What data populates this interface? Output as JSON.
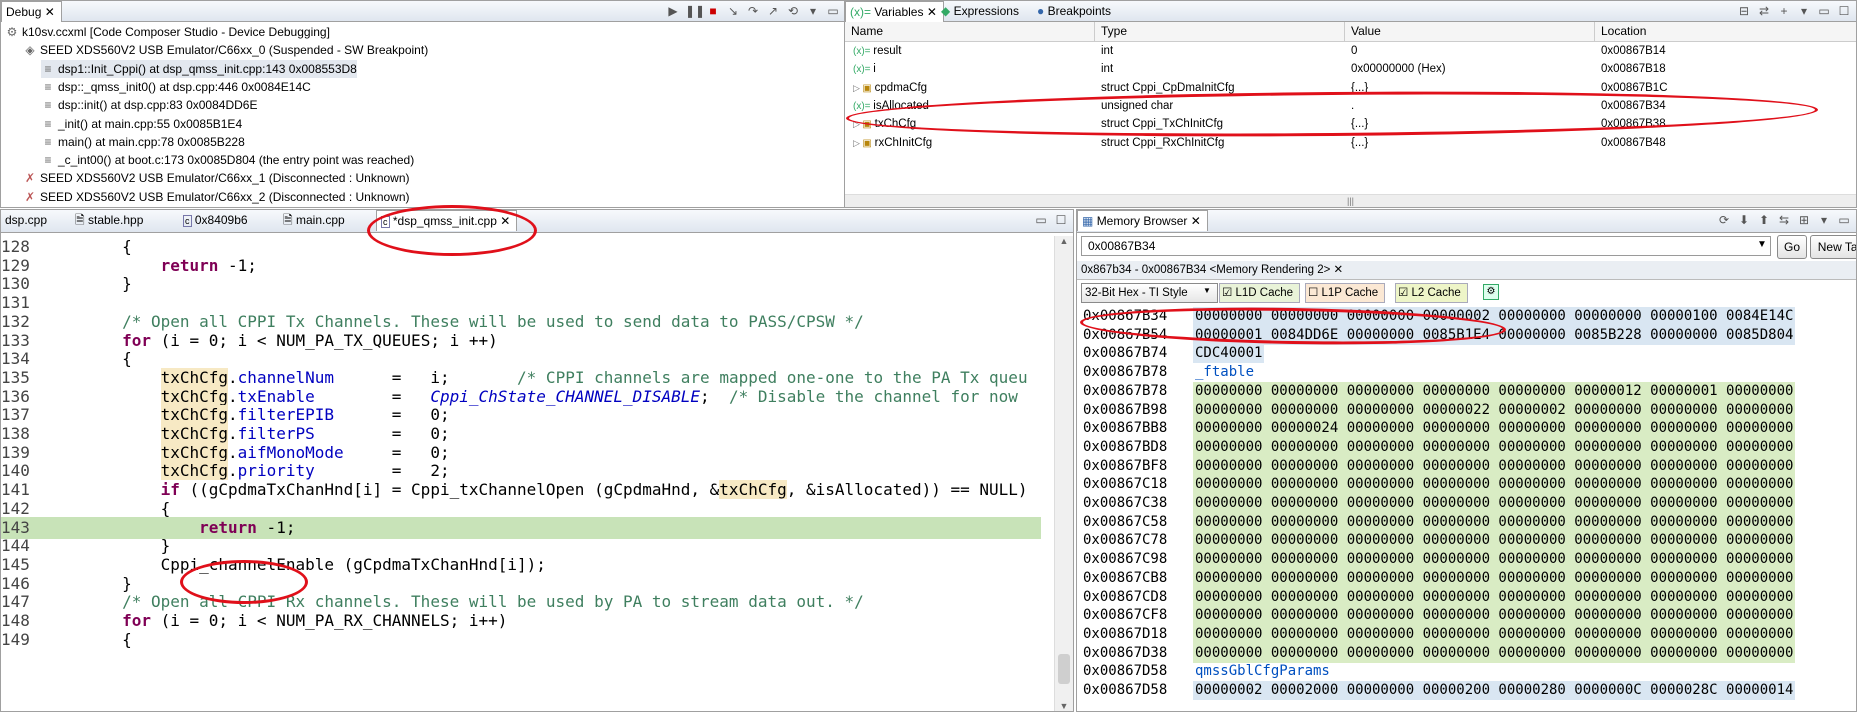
{
  "debug": {
    "tab_label": "Debug",
    "items": [
      {
        "text": "k10sv.ccxml [Code Composer Studio - Device Debugging]"
      },
      {
        "text": "SEED XDS560V2 USB Emulator/C66xx_0 (Suspended - SW Breakpoint)"
      },
      {
        "text": "dsp1::Init_Cppi() at dsp_qmss_init.cpp:143 0x008553D8"
      },
      {
        "text": "dsp::_qmss_init0() at dsp.cpp:446 0x0084E14C"
      },
      {
        "text": "dsp::init() at dsp.cpp:83 0x0084DD6E"
      },
      {
        "text": "_init() at main.cpp:55 0x0085B1E4"
      },
      {
        "text": "main() at main.cpp:78 0x0085B228"
      },
      {
        "text": "_c_int00() at boot.c:173 0x0085D804  (the entry point was reached)"
      },
      {
        "text": "SEED XDS560V2 USB Emulator/C66xx_1 (Disconnected : Unknown)"
      },
      {
        "text": "SEED XDS560V2 USB Emulator/C66xx_2 (Disconnected : Unknown)"
      }
    ]
  },
  "variables": {
    "tabs": [
      "Variables",
      "Expressions",
      "Breakpoints"
    ],
    "columns": [
      "Name",
      "Type",
      "Value",
      "Location"
    ],
    "rows": [
      {
        "name": "result",
        "type": "int",
        "value": "0",
        "location": "0x00867B14"
      },
      {
        "name": "i",
        "type": "int",
        "value": "0x00000000 (Hex)",
        "location": "0x00867B18"
      },
      {
        "name": "cpdmaCfg",
        "type": "struct Cppi_CpDmaInitCfg",
        "value": "{...}",
        "location": "0x00867B1C"
      },
      {
        "name": "isAllocated",
        "type": "unsigned char",
        "value": ".",
        "location": "0x00867B34"
      },
      {
        "name": "txChCfg",
        "type": "struct Cppi_TxChInitCfg",
        "value": "{...}",
        "location": "0x00867B38"
      },
      {
        "name": "rxChInitCfg",
        "type": "struct Cppi_RxChInitCfg",
        "value": "{...}",
        "location": "0x00867B48"
      }
    ]
  },
  "editor": {
    "tabs": [
      "dsp.cpp",
      "stable.hpp",
      "0x8409b6",
      "main.cpp",
      "*dsp_qmss_init.cpp"
    ],
    "lines": [
      {
        "n": "128",
        "t": "        {"
      },
      {
        "n": "129",
        "t": "            return -1;"
      },
      {
        "n": "130",
        "t": "        }"
      },
      {
        "n": "131",
        "t": ""
      },
      {
        "n": "132",
        "t": "        /* Open all CPPI Tx Channels. These will be used to send data to PASS/CPSW */"
      },
      {
        "n": "133",
        "t": "        for (i = 0; i < NUM_PA_TX_QUEUES; i ++)"
      },
      {
        "n": "134",
        "t": "        {"
      },
      {
        "n": "135",
        "t": "            txChCfg.channelNum      =   i;       /* CPPI channels are mapped one-one to the PA Tx queu"
      },
      {
        "n": "136",
        "t": "            txChCfg.txEnable        =   Cppi_ChState_CHANNEL_DISABLE;  /* Disable the channel for now"
      },
      {
        "n": "137",
        "t": "            txChCfg.filterEPIB      =   0;"
      },
      {
        "n": "138",
        "t": "            txChCfg.filterPS        =   0;"
      },
      {
        "n": "139",
        "t": "            txChCfg.aifMonoMode     =   0;"
      },
      {
        "n": "140",
        "t": "            txChCfg.priority        =   2;"
      },
      {
        "n": "141",
        "t": "            if ((gCpdmaTxChanHnd[i] = Cppi_txChannelOpen (gCpdmaHnd, &txChCfg, &isAllocated)) == NULL)"
      },
      {
        "n": "142",
        "t": "            {"
      },
      {
        "n": "143",
        "t": "                return -1;"
      },
      {
        "n": "144",
        "t": "            }"
      },
      {
        "n": "145",
        "t": "            Cppi_channelEnable (gCpdmaTxChanHnd[i]);"
      },
      {
        "n": "146",
        "t": "        }"
      },
      {
        "n": "147",
        "t": "        /* Open all CPPI Rx channels. These will be used by PA to stream data out. */"
      },
      {
        "n": "148",
        "t": "        for (i = 0; i < NUM_PA_RX_CHANNELS; i++)"
      },
      {
        "n": "149",
        "t": "        {"
      }
    ]
  },
  "memory": {
    "tab_label": "Memory Browser",
    "address_input": "0x00867B34",
    "go_label": "Go",
    "newtab_label": "New Tab",
    "rendering_tab": "0x867b34 - 0x00867B34 <Memory Rendering 2>",
    "format_select": "32-Bit Hex - TI Style",
    "cache_l1d": "L1D Cache",
    "cache_l1p": "L1P Cache",
    "cache_l2": "L2 Cache",
    "rows": [
      {
        "addr": "0x00867B34",
        "data": "00000000 00000000 00000000 00000002 00000000 00000000 00000100 0084E14C",
        "bg": "blue"
      },
      {
        "addr": "0x00867B54",
        "data": "00000001 0084DD6E 00000000 0085B1E4 00000000 0085B228 00000000 0085D804",
        "bg": "blue"
      },
      {
        "addr": "0x00867B74",
        "data": "CDC40001",
        "bg": "blue"
      },
      {
        "addr": "0x00867B78",
        "data": "_ftable",
        "bg": "label"
      },
      {
        "addr": "0x00867B78",
        "data": "00000000 00000000 00000000 00000000 00000000 00000012 00000001 00000000",
        "bg": "green"
      },
      {
        "addr": "0x00867B98",
        "data": "00000000 00000000 00000000 00000022 00000002 00000000 00000000 00000000",
        "bg": "green"
      },
      {
        "addr": "0x00867BB8",
        "data": "00000000 00000024 00000000 00000000 00000000 00000000 00000000 00000000",
        "bg": "green"
      },
      {
        "addr": "0x00867BD8",
        "data": "00000000 00000000 00000000 00000000 00000000 00000000 00000000 00000000",
        "bg": "green"
      },
      {
        "addr": "0x00867BF8",
        "data": "00000000 00000000 00000000 00000000 00000000 00000000 00000000 00000000",
        "bg": "green"
      },
      {
        "addr": "0x00867C18",
        "data": "00000000 00000000 00000000 00000000 00000000 00000000 00000000 00000000",
        "bg": "green"
      },
      {
        "addr": "0x00867C38",
        "data": "00000000 00000000 00000000 00000000 00000000 00000000 00000000 00000000",
        "bg": "green"
      },
      {
        "addr": "0x00867C58",
        "data": "00000000 00000000 00000000 00000000 00000000 00000000 00000000 00000000",
        "bg": "green"
      },
      {
        "addr": "0x00867C78",
        "data": "00000000 00000000 00000000 00000000 00000000 00000000 00000000 00000000",
        "bg": "green"
      },
      {
        "addr": "0x00867C98",
        "data": "00000000 00000000 00000000 00000000 00000000 00000000 00000000 00000000",
        "bg": "green"
      },
      {
        "addr": "0x00867CB8",
        "data": "00000000 00000000 00000000 00000000 00000000 00000000 00000000 00000000",
        "bg": "green"
      },
      {
        "addr": "0x00867CD8",
        "data": "00000000 00000000 00000000 00000000 00000000 00000000 00000000 00000000",
        "bg": "green"
      },
      {
        "addr": "0x00867CF8",
        "data": "00000000 00000000 00000000 00000000 00000000 00000000 00000000 00000000",
        "bg": "green"
      },
      {
        "addr": "0x00867D18",
        "data": "00000000 00000000 00000000 00000000 00000000 00000000 00000000 00000000",
        "bg": "green"
      },
      {
        "addr": "0x00867D38",
        "data": "00000000 00000000 00000000 00000000 00000000 00000000 00000000 00000000",
        "bg": "green"
      },
      {
        "addr": "0x00867D58",
        "data": "qmssGblCfgParams",
        "bg": "label"
      },
      {
        "addr": "0x00867D58",
        "data": "00000002 00002000 00000000 00000200 00000280 0000000C 0000028C 00000014",
        "bg": "blue"
      }
    ]
  },
  "colors": {
    "annotation": "#e0101a",
    "current_line": "#c8e3b8",
    "memory_changed": "#d9ecc4"
  }
}
